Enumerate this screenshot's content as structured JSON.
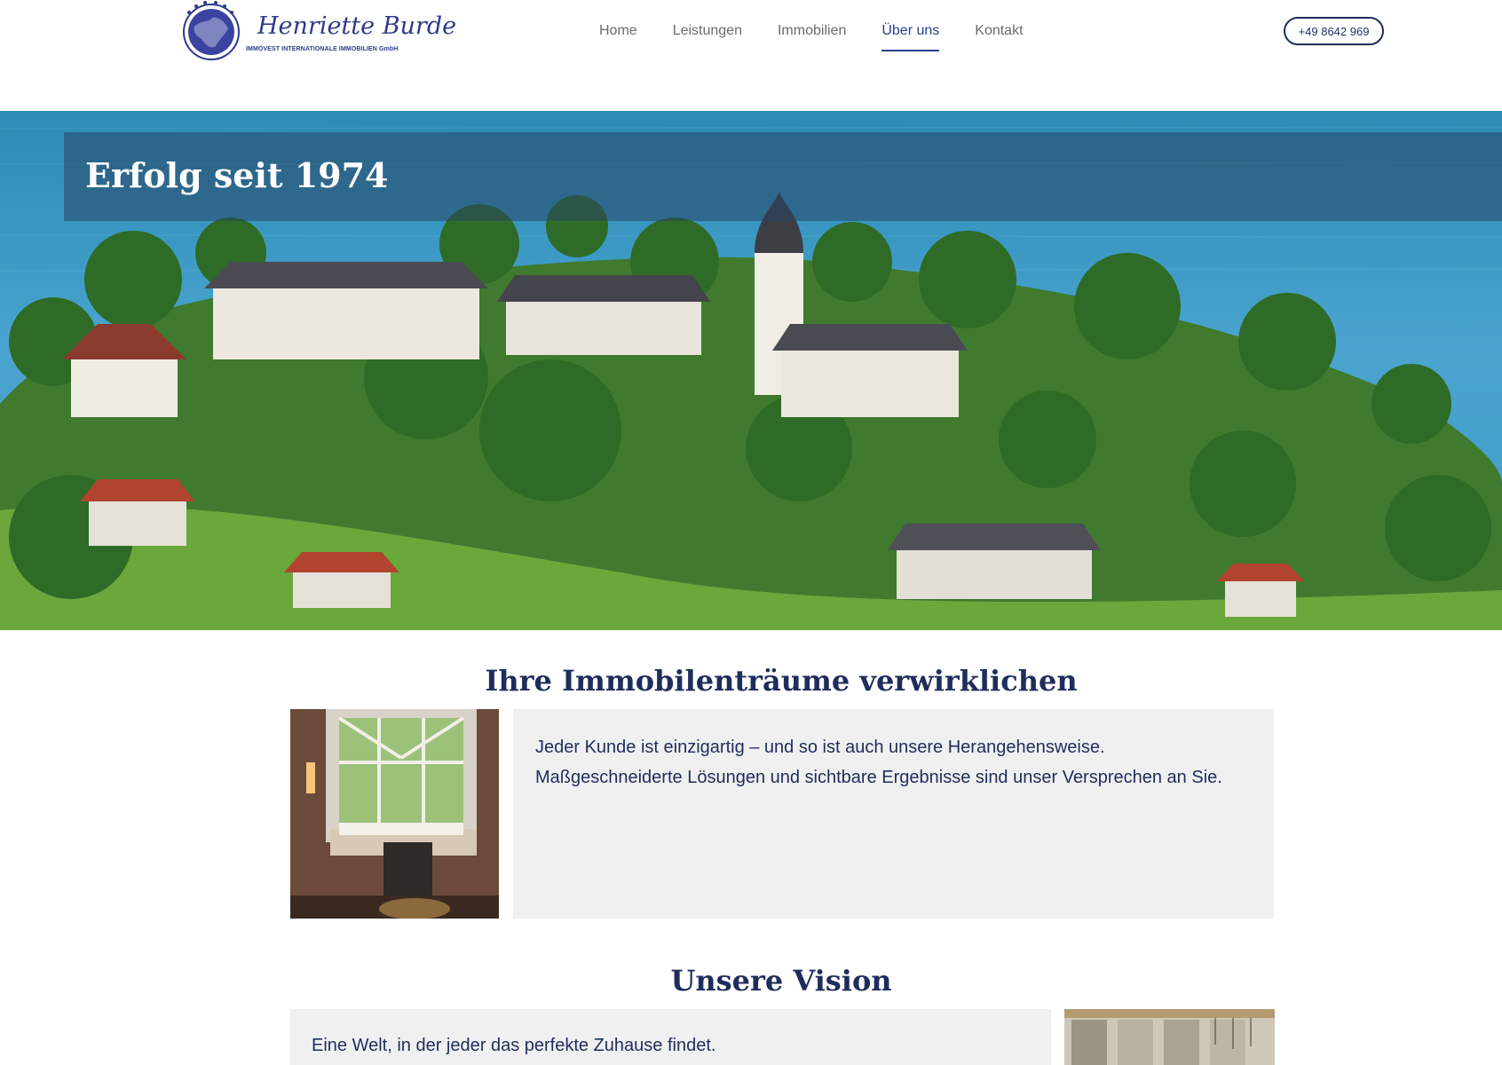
{
  "logo": {
    "script_name": "Henriette Burde",
    "company": "IMMOVEST INTERNATIONALE IMMOBILIEN GmbH"
  },
  "nav": {
    "items": [
      {
        "label": "Home",
        "active": false
      },
      {
        "label": "Leistungen",
        "active": false
      },
      {
        "label": "Immobilien",
        "active": false
      },
      {
        "label": "Über uns",
        "active": true
      },
      {
        "label": "Kontakt",
        "active": false
      }
    ]
  },
  "phone": "+49 8642 969",
  "hero": {
    "title": "Erfolg seit 1974"
  },
  "section1": {
    "title": "Ihre Immobilenträume verwirklichen",
    "text_line1": "Jeder Kunde ist einzigartig – und so ist auch unsere Herangehensweise.",
    "text_line2": "Maßgeschneiderte Lösungen und sichtbare Ergebnisse sind unser Versprechen an Sie."
  },
  "section2": {
    "title": "Unsere Vision",
    "text_line1": "Eine Welt, in der jeder das perfekte Zuhause findet."
  },
  "colors": {
    "brand_navy": "#1f2d5c",
    "nav_active": "#2a3f8f",
    "card_bg": "#f0f0f0"
  }
}
